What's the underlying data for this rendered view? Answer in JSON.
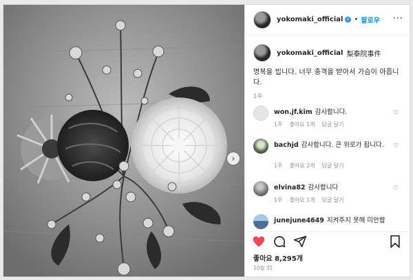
{
  "post": {
    "username": "yokomaki_official",
    "follow_label": "팔로우",
    "more_icon": "more-horizontal-icon",
    "verified_icon": "verified-badge-icon"
  },
  "caption": {
    "username": "yokomaki_official",
    "tag": "梨泰院事件",
    "text": "명복을 빕니다. 너무 충격을 받아서 가슴이 아픕니다.",
    "time": "1주"
  },
  "comments": [
    {
      "username": "won.jf.kim",
      "text": "감사합니다.",
      "time": "1주",
      "likes": "좋아요 1개",
      "reply": "답글 달기"
    },
    {
      "username": "bachjd",
      "text": "감사합니다. 큰 위로가 됩니다.",
      "time": "1주",
      "likes": "좋아요 2개",
      "reply": "답글 달기"
    },
    {
      "username": "elvina82",
      "text": "감사합니다",
      "time": "1주",
      "likes": "좋아요 1개",
      "reply": "답글 달기"
    },
    {
      "username": "junejune4649",
      "text": "지켜주지 못해 미안합"
    }
  ],
  "actions": {
    "likes": "좋아요 8,295개",
    "date": "10월 31"
  },
  "colors": {
    "link_blue": "#0095f6",
    "like_red": "#ed4956",
    "muted": "#8e8e8e"
  }
}
